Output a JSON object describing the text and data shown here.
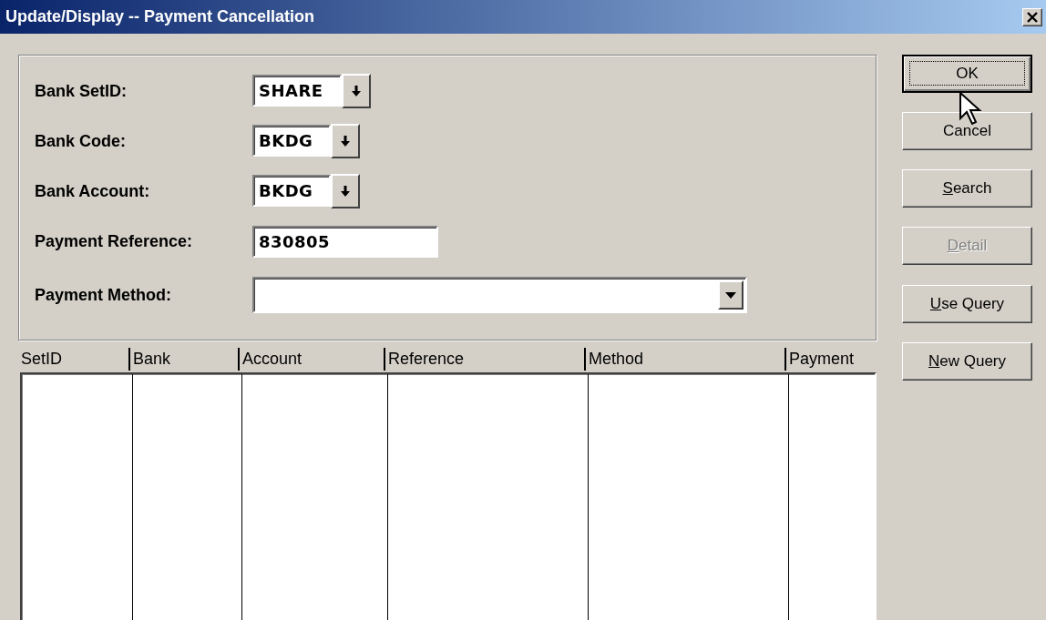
{
  "window": {
    "title": "Update/Display -- Payment Cancellation"
  },
  "fields": [
    {
      "label": "Bank SetID:",
      "kind": "prompt",
      "value": "SHARE"
    },
    {
      "label": "Bank Code:",
      "kind": "prompt",
      "value": "BKDG"
    },
    {
      "label": "Bank Account:",
      "kind": "prompt",
      "value": "BKDG"
    },
    {
      "label": "Payment Reference:",
      "kind": "text",
      "value": "830805"
    },
    {
      "label": "Payment Method:",
      "kind": "combo"
    }
  ],
  "list": {
    "columns": [
      "SetID",
      "Bank",
      "Account",
      "Reference",
      "Method",
      "Payment"
    ]
  },
  "button_groups": [
    [
      {
        "label": "OK",
        "default": true,
        "disabled": false,
        "mnemonic": false
      },
      {
        "label": "Cancel",
        "default": false,
        "disabled": false,
        "mnemonic": false
      },
      {
        "label": "Search",
        "default": false,
        "disabled": false,
        "mnemonic": true
      },
      {
        "label": "Detail",
        "default": false,
        "disabled": true,
        "mnemonic": true
      }
    ],
    [
      {
        "label": "Use Query",
        "default": false,
        "disabled": false,
        "mnemonic": true
      },
      {
        "label": "New Query",
        "default": false,
        "disabled": false,
        "mnemonic": true
      }
    ]
  ]
}
